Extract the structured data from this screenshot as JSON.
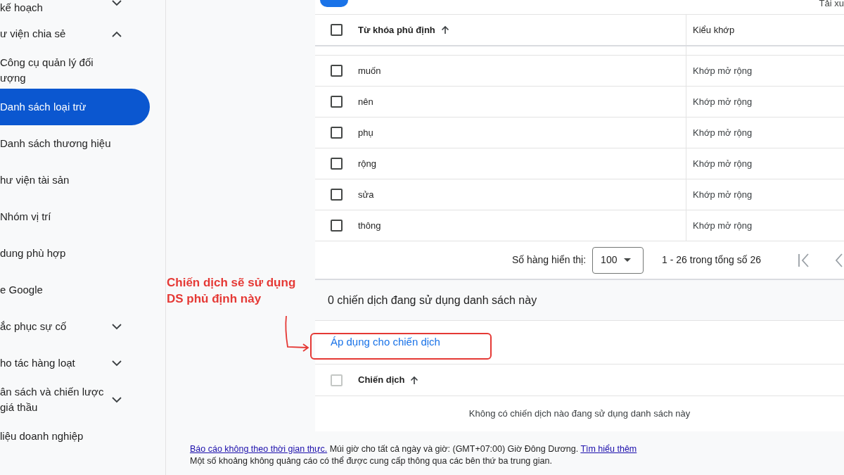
{
  "sidebar": {
    "items": [
      {
        "label": "kế hoạch",
        "expanded": false,
        "selected": false,
        "kind": "group"
      },
      {
        "label": "ư viện chia sẻ",
        "expanded": true,
        "selected": false,
        "kind": "group"
      },
      {
        "label": "Công cụ quản lý đối ượng",
        "selected": false,
        "kind": "link"
      },
      {
        "label": "Danh sách loại trừ",
        "selected": true,
        "kind": "link"
      },
      {
        "label": "Danh sách thương hiệu",
        "selected": false,
        "kind": "link"
      },
      {
        "label": "hư viện tài sản",
        "selected": false,
        "kind": "link"
      },
      {
        "label": "Nhóm vị trí",
        "selected": false,
        "kind": "link"
      },
      {
        "label": "dung phù hợp",
        "selected": false,
        "kind": "link"
      },
      {
        "label": "e Google",
        "selected": false,
        "kind": "link"
      },
      {
        "label": "ắc phục sự cố",
        "expanded": false,
        "selected": false,
        "kind": "group"
      },
      {
        "label": "ho tác hàng loạt",
        "expanded": false,
        "selected": false,
        "kind": "group"
      },
      {
        "label": "ân sách và chiến lược giá thầu",
        "expanded": false,
        "selected": false,
        "kind": "group"
      },
      {
        "label": "liệu doanh nghiệp",
        "selected": false,
        "kind": "link"
      }
    ]
  },
  "annotation": {
    "text": "Chiến dịch sẽ sử dụng DS phủ định này"
  },
  "panel": {
    "top_action": "Tải xu",
    "keywords_table": {
      "columns": [
        "Từ khóa phủ định",
        "Kiểu khớp"
      ],
      "header_checked": false,
      "rows": [
        {
          "keyword": "muốn",
          "match": "Khớp mở rộng",
          "checked": false
        },
        {
          "keyword": "nên",
          "match": "Khớp mở rộng",
          "checked": false
        },
        {
          "keyword": "phụ",
          "match": "Khớp mở rộng",
          "checked": false
        },
        {
          "keyword": "rộng",
          "match": "Khớp mở rộng",
          "checked": false
        },
        {
          "keyword": "sửa",
          "match": "Khớp mở rộng",
          "checked": false
        },
        {
          "keyword": "thông",
          "match": "Khớp mở rộng",
          "checked": false
        }
      ]
    },
    "pagination": {
      "rows_label": "Số hàng hiển thị:",
      "rows_value": "100",
      "range": "1 - 26 trong tổng số 26"
    },
    "campaigns": {
      "summary": "0 chiến dịch đang sử dụng danh sách này",
      "apply_link": "Áp dụng cho chiến dịch",
      "column": "Chiến dịch",
      "header_checked": false,
      "empty": "Không có chiến dịch nào đang sử dụng danh sách này"
    }
  },
  "footer": {
    "link1": "Báo cáo không theo thời gian thực.",
    "timezone": "Múi giờ cho tất cả ngày và giờ: (GMT+07:00) Giờ Đông Dương.",
    "link2": "Tìm hiểu thêm",
    "note": "Một số khoảng không quảng cáo có thể được cung cấp thông qua các bên thứ ba trung gian."
  }
}
